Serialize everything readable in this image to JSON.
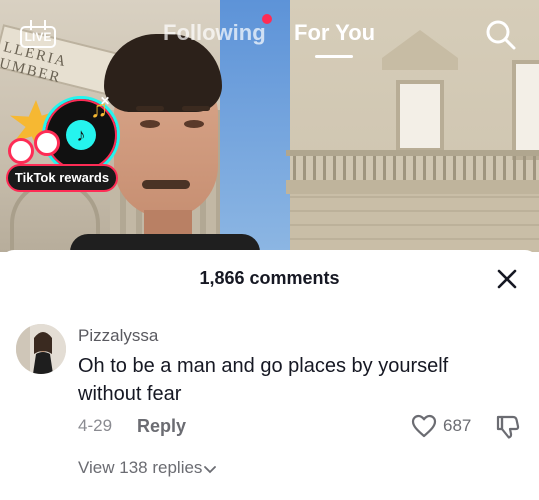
{
  "topnav": {
    "live_label": "LIVE",
    "tabs": [
      {
        "label": "Following",
        "active": false,
        "has_notification_dot": true
      },
      {
        "label": "For You",
        "active": true
      }
    ],
    "search_icon": "search-icon"
  },
  "video": {
    "sign_text": "LLERIA UMBER"
  },
  "rewards": {
    "label": "TikTok rewards"
  },
  "comments": {
    "header": "1,866 comments",
    "close_icon": "close-icon",
    "items": [
      {
        "username": "Pizzalyssa",
        "text": "Oh to be a man and go places by yourself without fear",
        "date": "4-29",
        "reply_label": "Reply",
        "likes": "687",
        "view_replies": "View 138 replies"
      }
    ]
  },
  "colors": {
    "accent_red": "#fe2c55",
    "accent_cyan": "#25f4ee",
    "text_primary": "#161823",
    "text_secondary": "#8a8b91"
  }
}
